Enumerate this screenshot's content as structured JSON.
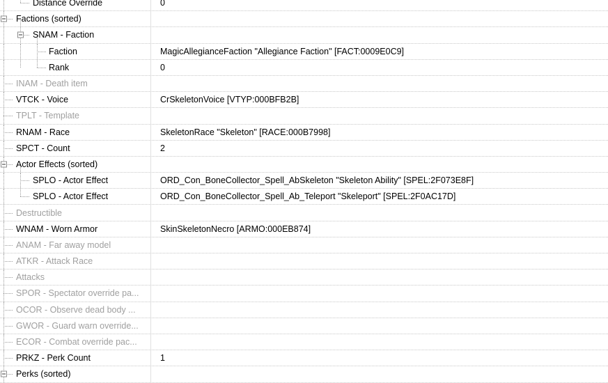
{
  "rows": [
    {
      "name": "Distance Override",
      "value": "0",
      "level": 1,
      "muted": false,
      "expander": false
    },
    {
      "name": "Factions (sorted)",
      "value": "",
      "level": 0,
      "muted": false,
      "expander": true
    },
    {
      "name": "SNAM - Faction",
      "value": "",
      "level": 1,
      "muted": false,
      "expander": true
    },
    {
      "name": "Faction",
      "value": "MagicAllegianceFaction \"Allegiance Faction\" [FACT:0009E0C9]",
      "level": 2,
      "muted": false,
      "expander": false
    },
    {
      "name": "Rank",
      "value": "0",
      "level": 2,
      "muted": false,
      "expander": false
    },
    {
      "name": "INAM - Death item",
      "value": "",
      "level": 0,
      "muted": true,
      "expander": false
    },
    {
      "name": "VTCK - Voice",
      "value": "CrSkeletonVoice [VTYP:000BFB2B]",
      "level": 0,
      "muted": false,
      "expander": false
    },
    {
      "name": "TPLT - Template",
      "value": "",
      "level": 0,
      "muted": true,
      "expander": false
    },
    {
      "name": "RNAM - Race",
      "value": "SkeletonRace \"Skeleton\" [RACE:000B7998]",
      "level": 0,
      "muted": false,
      "expander": false
    },
    {
      "name": "SPCT - Count",
      "value": "2",
      "level": 0,
      "muted": false,
      "expander": false
    },
    {
      "name": "Actor Effects (sorted)",
      "value": "",
      "level": 0,
      "muted": false,
      "expander": true
    },
    {
      "name": "SPLO - Actor Effect",
      "value": "ORD_Con_BoneCollector_Spell_AbSkeleton \"Skeleton Ability\" [SPEL:2F073E8F]",
      "level": 1,
      "muted": false,
      "expander": false
    },
    {
      "name": "SPLO - Actor Effect",
      "value": "ORD_Con_BoneCollector_Spell_Ab_Teleport \"Skeleport\" [SPEL:2F0AC17D]",
      "level": 1,
      "muted": false,
      "expander": false
    },
    {
      "name": "Destructible",
      "value": "",
      "level": 0,
      "muted": true,
      "expander": false
    },
    {
      "name": "WNAM - Worn Armor",
      "value": "SkinSkeletonNecro [ARMO:000EB874]",
      "level": 0,
      "muted": false,
      "expander": false
    },
    {
      "name": "ANAM - Far away model",
      "value": "",
      "level": 0,
      "muted": true,
      "expander": false
    },
    {
      "name": "ATKR - Attack Race",
      "value": "",
      "level": 0,
      "muted": true,
      "expander": false
    },
    {
      "name": "Attacks",
      "value": "",
      "level": 0,
      "muted": true,
      "expander": false
    },
    {
      "name": "SPOR - Spectator override pa...",
      "value": "",
      "level": 0,
      "muted": true,
      "expander": false
    },
    {
      "name": "OCOR - Observe dead body ...",
      "value": "",
      "level": 0,
      "muted": true,
      "expander": false
    },
    {
      "name": "GWOR - Guard warn override...",
      "value": "",
      "level": 0,
      "muted": true,
      "expander": false
    },
    {
      "name": "ECOR - Combat override pac...",
      "value": "",
      "level": 0,
      "muted": true,
      "expander": false
    },
    {
      "name": "PRKZ - Perk Count",
      "value": "1",
      "level": 0,
      "muted": false,
      "expander": false
    },
    {
      "name": "Perks (sorted)",
      "value": "",
      "level": 0,
      "muted": false,
      "expander": true
    }
  ]
}
